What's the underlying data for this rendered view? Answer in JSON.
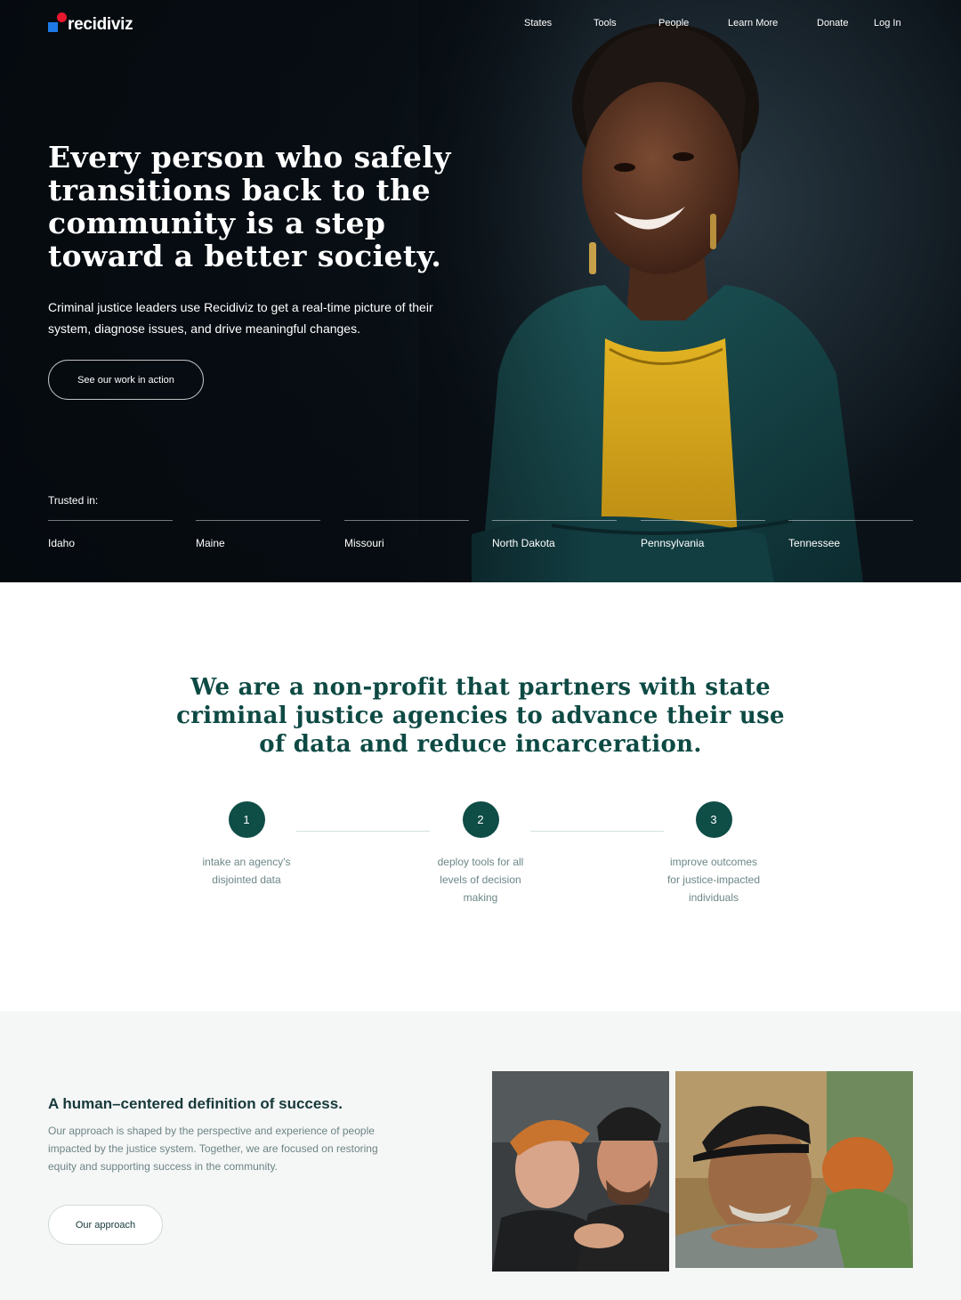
{
  "brand": {
    "name": "recidiviz",
    "blue": "#1e7ae6",
    "red": "#e8172e",
    "teal": "#0f4d47"
  },
  "nav": {
    "items": [
      "States",
      "Tools",
      "People",
      "Learn More",
      "Donate",
      "Log In"
    ]
  },
  "hero": {
    "title": "Every person who safely transitions back to the community is a step toward a better society.",
    "subtitle": "Criminal justice leaders use Recidiviz to get a real-time picture of their system, diagnose issues, and drive meaningful changes.",
    "cta_label": "See our work in action",
    "trusted_label": "Trusted in:",
    "states": [
      "Idaho",
      "Maine",
      "Missouri",
      "North Dakota",
      "Pennsylvania",
      "Tennessee"
    ]
  },
  "mission": {
    "title": "We are a non-profit that partners with state criminal justice agencies to advance their use of data and reduce incarceration.",
    "steps": [
      {
        "number": "1",
        "text": "intake an agency's disjointed data"
      },
      {
        "number": "2",
        "text": "deploy tools for all levels of decision making"
      },
      {
        "number": "3",
        "text": "improve outcomes for justice-impacted individuals"
      }
    ]
  },
  "approach": {
    "title": "A human–centered definition of success.",
    "body": "Our approach is shaped by the perspective and experience of people impacted by the justice system. Together, we are focused on restoring equity and supporting success in the community.",
    "cta_label": "Our approach"
  }
}
